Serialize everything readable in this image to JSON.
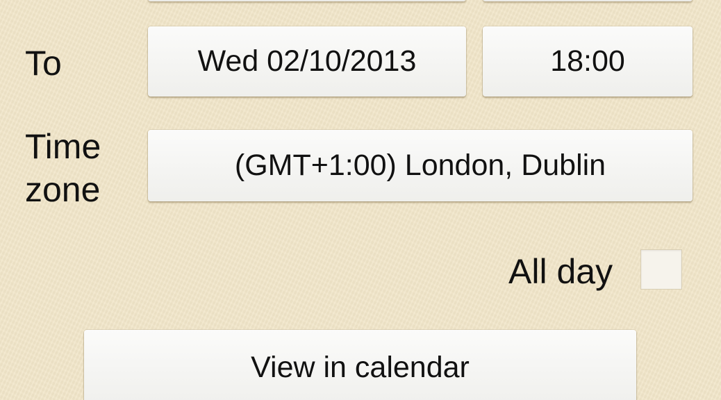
{
  "end": {
    "label": "To",
    "date": "Wed 02/10/2013",
    "time": "18:00"
  },
  "timezone": {
    "label_line1": "Time",
    "label_line2": "zone",
    "value": "(GMT+1:00) London, Dublin"
  },
  "all_day": {
    "label": "All day",
    "checked": false
  },
  "actions": {
    "view_in_calendar": "View in calendar"
  }
}
